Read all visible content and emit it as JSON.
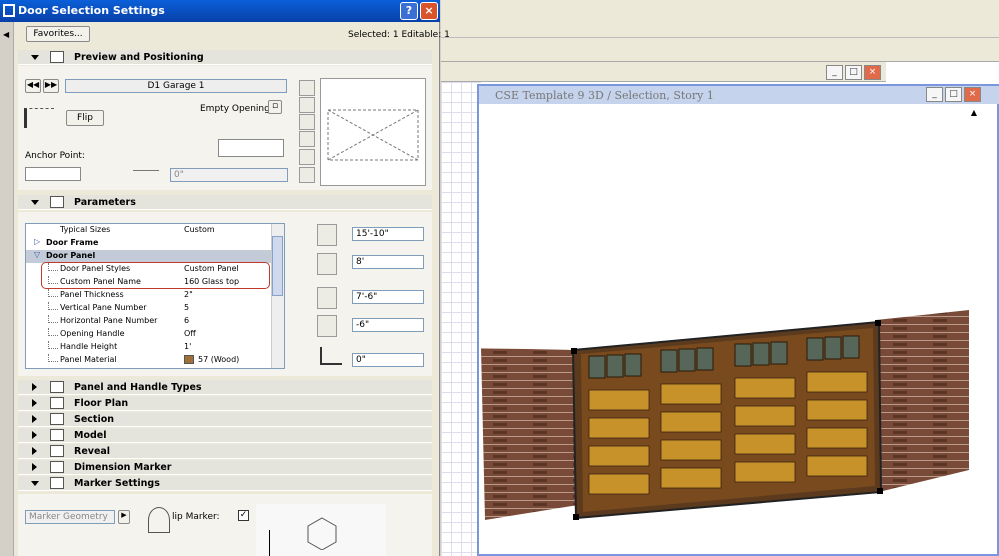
{
  "dialog": {
    "title": "Door Selection Settings",
    "help": "?",
    "close": "×",
    "favorites": "Favorites...",
    "selection_status": "Selected: 1 Editable: 1",
    "preview_section": "Preview and Positioning",
    "door_name": "D1 Garage 1",
    "empty_opening": "Empty Opening",
    "flip": "Flip",
    "anchor_point": "Anchor Point:",
    "anchor_value": "0\"",
    "parameters_section": "Parameters",
    "params": [
      {
        "key": "Typical Sizes",
        "value": "Custom",
        "type": "plain"
      },
      {
        "key": "Door Frame",
        "value": "",
        "type": "group-closed"
      },
      {
        "key": "Door Panel",
        "value": "",
        "type": "group-open"
      },
      {
        "key": "Door Panel Styles",
        "value": "Custom Panel",
        "type": "child"
      },
      {
        "key": "Custom Panel Name",
        "value": "160 Glass top",
        "type": "child"
      },
      {
        "key": "Panel Thickness",
        "value": "2\"",
        "type": "child"
      },
      {
        "key": "Vertical Pane Number",
        "value": "5",
        "type": "child"
      },
      {
        "key": "Horizontal Pane Number",
        "value": "6",
        "type": "child"
      },
      {
        "key": "Opening Handle",
        "value": "Off",
        "type": "child"
      },
      {
        "key": "Handle Height",
        "value": "1'",
        "type": "child"
      },
      {
        "key": "Panel Material",
        "value": "57 (Wood)",
        "type": "child-material"
      }
    ],
    "dims": {
      "width": "15'-10\"",
      "height": "8'",
      "sill": "7'-6\"",
      "offset": "-6\"",
      "reveal": "0\""
    },
    "sections": [
      {
        "label": "Panel and Handle Types"
      },
      {
        "label": "Floor Plan"
      },
      {
        "label": "Section"
      },
      {
        "label": "Model"
      },
      {
        "label": "Reveal"
      },
      {
        "label": "Dimension Marker"
      },
      {
        "label": "Marker Settings"
      }
    ],
    "marker_geometry": "Marker Geometry",
    "flip_marker": "lip Marker:",
    "panel_color": "#a0703a",
    "highlight_color": "#c0392b"
  },
  "view3d": {
    "title": "CSE Template 9 3D / Selection, Story 1",
    "min": "_",
    "max": "□",
    "close": "×"
  }
}
